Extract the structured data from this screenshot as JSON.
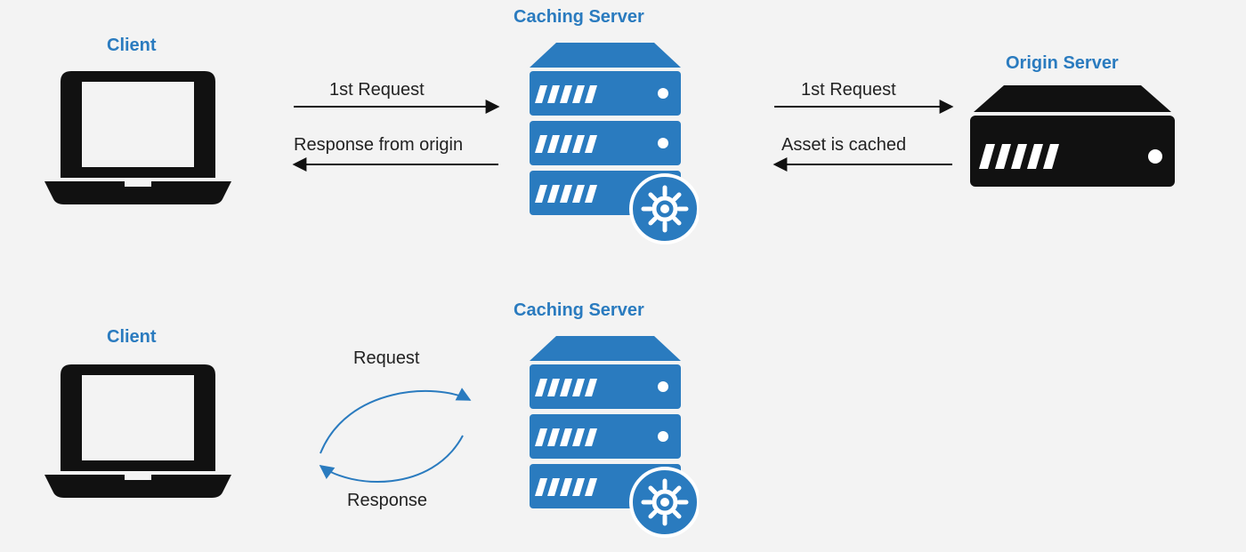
{
  "titles": {
    "client_top": "Client",
    "client_bottom": "Client",
    "caching_top": "Caching Server",
    "caching_bottom": "Caching Server",
    "origin": "Origin Server"
  },
  "labels": {
    "req_client_to_cache": "1st Request",
    "resp_cache_to_client": "Response from origin",
    "req_cache_to_origin": "1st Request",
    "resp_origin_to_cache": "Asset is cached",
    "loop_request": "Request",
    "loop_response": "Response"
  },
  "colors": {
    "accent": "#2a7bbf",
    "ink": "#111111",
    "bg": "#f3f3f3"
  }
}
